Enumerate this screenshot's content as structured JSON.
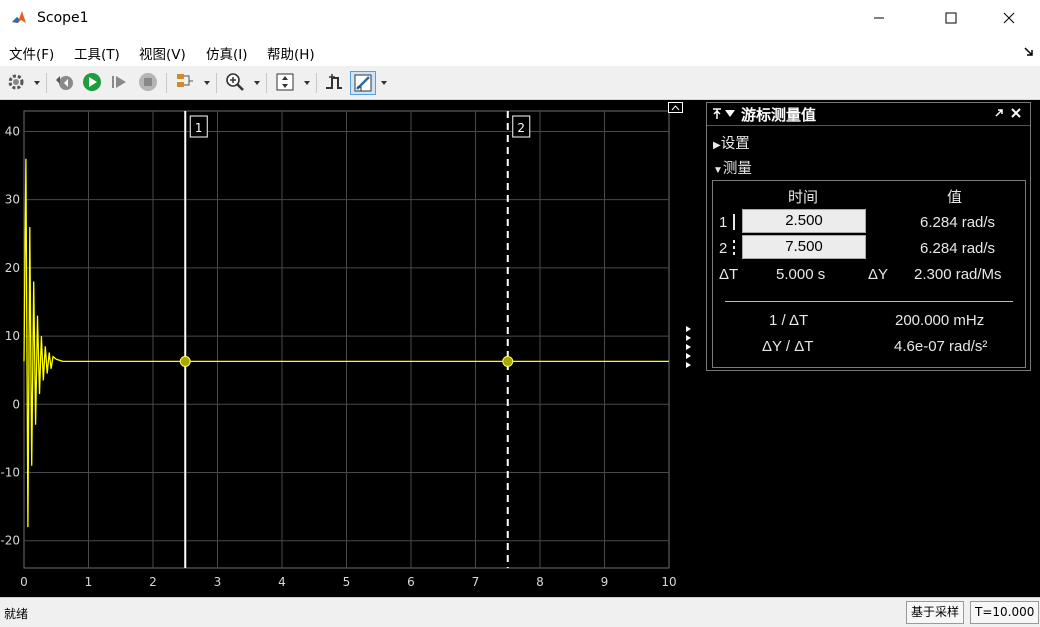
{
  "window": {
    "title": "Scope1"
  },
  "menu": [
    {
      "label": "文件(F)"
    },
    {
      "label": "工具(T)"
    },
    {
      "label": "视图(V)"
    },
    {
      "label": "仿真(I)"
    },
    {
      "label": "帮助(H)"
    }
  ],
  "toolbar": {
    "items": [
      "settings-icon",
      "step-back-icon",
      "run-icon",
      "step-forward-icon",
      "stop-icon",
      "layout-icon",
      "zoom-in-icon",
      "scale-axes-icon",
      "triggers-icon",
      "cursor-measurements-icon"
    ]
  },
  "plot": {
    "x_ticks": [
      "0",
      "1",
      "2",
      "3",
      "4",
      "5",
      "6",
      "7",
      "8",
      "9",
      "10"
    ],
    "y_ticks": [
      "40",
      "30",
      "20",
      "10",
      "0",
      "-10",
      "-20"
    ],
    "line_color": "#ffff00",
    "cursor1": {
      "label": "1",
      "x": 2.5
    },
    "cursor2": {
      "label": "2",
      "x": 7.5
    },
    "chart_data": {
      "type": "line",
      "title": "",
      "xlabel": "",
      "ylabel": "",
      "xlim": [
        0,
        10
      ],
      "ylim": [
        -24,
        43
      ],
      "grid": true,
      "steady_value": 6.284,
      "series": [
        {
          "color": "#ffff00",
          "x": [
            0,
            0.03,
            0.06,
            0.09,
            0.12,
            0.15,
            0.18,
            0.21,
            0.24,
            0.27,
            0.3,
            0.33,
            0.36,
            0.39,
            0.42,
            0.45,
            0.5,
            0.6,
            0.8,
            1.0,
            2.5,
            5.0,
            7.5,
            10.0
          ],
          "y": [
            6.3,
            36,
            -18,
            26,
            -9,
            18,
            -3,
            13,
            1.5,
            10,
            3.5,
            8.5,
            4.5,
            7.6,
            5.2,
            7.0,
            6.6,
            6.3,
            6.284,
            6.284,
            6.284,
            6.284,
            6.284,
            6.284
          ]
        }
      ]
    }
  },
  "cursor_panel": {
    "title": "游标测量值",
    "settings_label": "设置",
    "measurements_label": "测量",
    "col_time": "时间",
    "col_value": "值",
    "row1_label": "1",
    "row1_time": "2.500",
    "row1_value": "6.284 rad/s",
    "row2_label": "2",
    "row2_time": "7.500",
    "row2_value": "6.284 rad/s",
    "dt_label": "ΔT",
    "dt_value": "5.000 s",
    "dy_label": "ΔY",
    "dy_value": "2.300 rad/Ms",
    "inv_dt_label": "1 / ΔT",
    "inv_dt_value": "200.000 mHz",
    "slope_label": "ΔY / ΔT",
    "slope_value": "4.6e-07 rad/s²"
  },
  "status": {
    "left": "就绪",
    "mode": "基于采样",
    "time": "T=10.000"
  }
}
